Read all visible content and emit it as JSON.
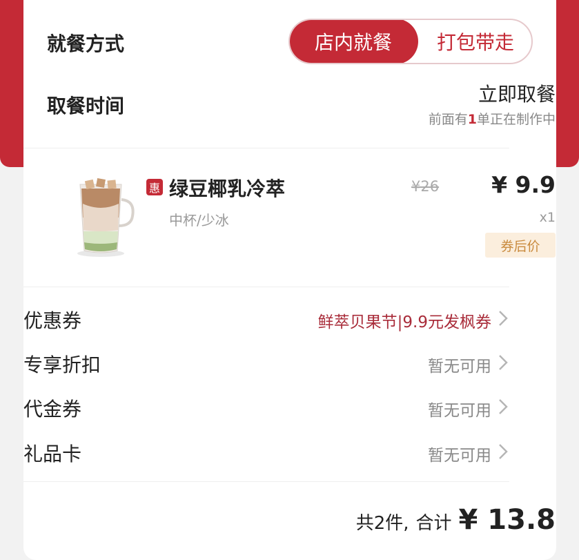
{
  "dining": {
    "label": "就餐方式",
    "options": [
      "店内就餐",
      "打包带走"
    ],
    "selected": "店内就餐"
  },
  "pickup": {
    "label": "取餐时间",
    "value": "立即取餐",
    "queue_prefix": "前面有",
    "queue_count": "1",
    "queue_suffix": "单正在制作中"
  },
  "product": {
    "badge": "惠",
    "name": "绿豆椰乳冷萃",
    "spec": "中杯/少冰",
    "original_price": "¥26",
    "price": "¥ 9.9",
    "quantity": "x1",
    "tag": "券后价"
  },
  "options": [
    {
      "label": "优惠券",
      "value": "鲜萃贝果节|9.9元发枫券",
      "highlight": true
    },
    {
      "label": "专享折扣",
      "value": "暂无可用",
      "highlight": false
    },
    {
      "label": "代金券",
      "value": "暂无可用",
      "highlight": false
    },
    {
      "label": "礼品卡",
      "value": "暂无可用",
      "highlight": false
    }
  ],
  "summary": {
    "count": "共2件,",
    "total_label": "合计",
    "total_amount": "¥ 13.8"
  },
  "colors": {
    "brand_red": "#c42a36",
    "coupon_text": "#a92c3a",
    "tag_bg": "#fbeedd",
    "tag_text": "#c98a3d"
  }
}
